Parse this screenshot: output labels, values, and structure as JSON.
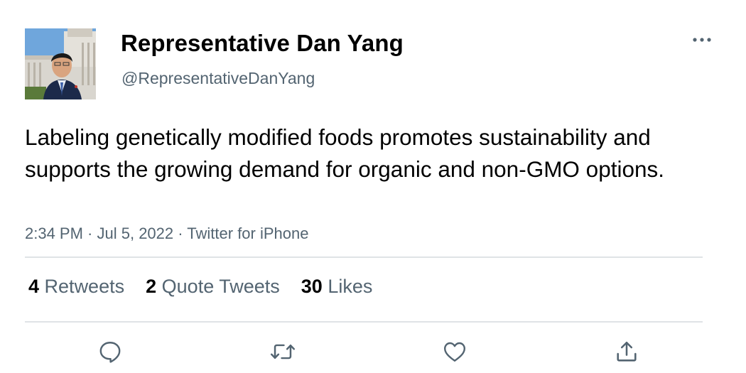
{
  "tweet": {
    "author": {
      "display_name": "Representative Dan Yang",
      "handle": "@RepresentativeDanYang"
    },
    "text": "Labeling genetically modified foods promotes sustainability and supports the growing demand for organic and non-GMO options.",
    "meta": {
      "time": "2:34 PM",
      "separator1": " · ",
      "date": "Jul 5, 2022",
      "separator2": " · ",
      "source": "Twitter for iPhone"
    },
    "stats": {
      "retweets_count": "4",
      "retweets_label": "Retweets",
      "quotes_count": "2",
      "quotes_label": "Quote Tweets",
      "likes_count": "30",
      "likes_label": "Likes"
    },
    "actions": {
      "reply_icon": "reply-icon",
      "retweet_icon": "retweet-icon",
      "like_icon": "heart-icon",
      "share_icon": "share-icon"
    }
  },
  "colors": {
    "text_primary": "#000000",
    "text_secondary": "#536471",
    "divider": "#dfe3e6",
    "icon": "#536471"
  }
}
